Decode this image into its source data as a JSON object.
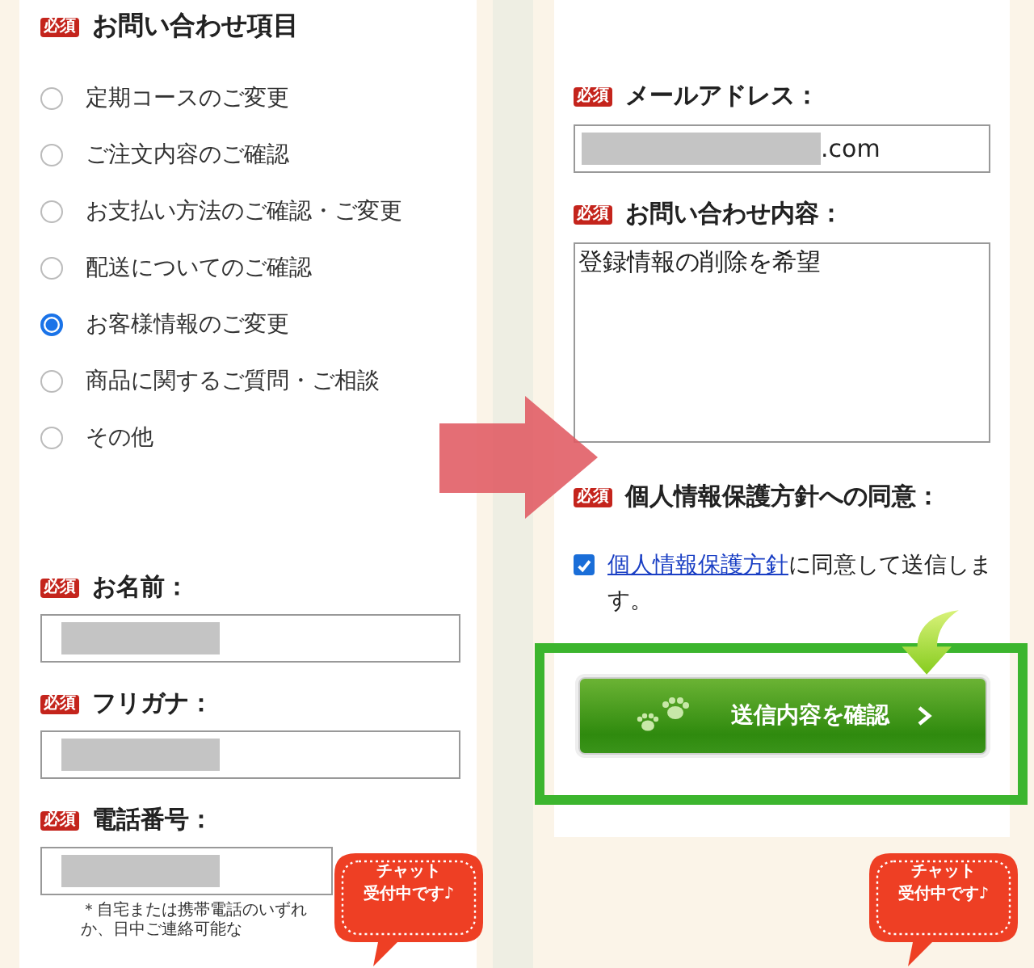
{
  "left_panel": {
    "inquiry_type": {
      "badge": "必須",
      "label": "お問い合わせ項目",
      "options": [
        {
          "label": "定期コースのご変更",
          "selected": false
        },
        {
          "label": "ご注文内容のご確認",
          "selected": false
        },
        {
          "label": "お支払い方法のご確認・ご変更",
          "selected": false
        },
        {
          "label": "配送についてのご確認",
          "selected": false
        },
        {
          "label": "お客様情報のご変更",
          "selected": true
        },
        {
          "label": "商品に関するご質問・ご相談",
          "selected": false
        },
        {
          "label": "その他",
          "selected": false
        }
      ]
    },
    "fields": [
      {
        "badge": "必須",
        "label": "お名前：",
        "masked": true
      },
      {
        "badge": "必須",
        "label": "フリガナ：",
        "masked": true
      },
      {
        "badge": "必須",
        "label": "電話番号：",
        "masked": true
      }
    ],
    "phone_note": "＊自宅または携帯電話のいずれか、日中ご連絡可能な"
  },
  "right_panel": {
    "email": {
      "badge": "必須",
      "label": "メールアドレス：",
      "masked": true,
      "value": ".com"
    },
    "message": {
      "badge": "必須",
      "label": "お問い合わせ内容：",
      "value": "登録情報の削除を希望"
    },
    "consent": {
      "badge": "必須",
      "label": "個人情報保護方針への同意：",
      "checked": true,
      "link": "個人情報保護方針",
      "text": "に同意して送信します。"
    },
    "submit_button": {
      "label": "送信内容を確認"
    }
  },
  "chat_buttons": [
    {
      "line1": "チャット",
      "line2": "受付中です♪"
    },
    {
      "line1": "チャット",
      "line2": "受付中です♪"
    }
  ]
}
